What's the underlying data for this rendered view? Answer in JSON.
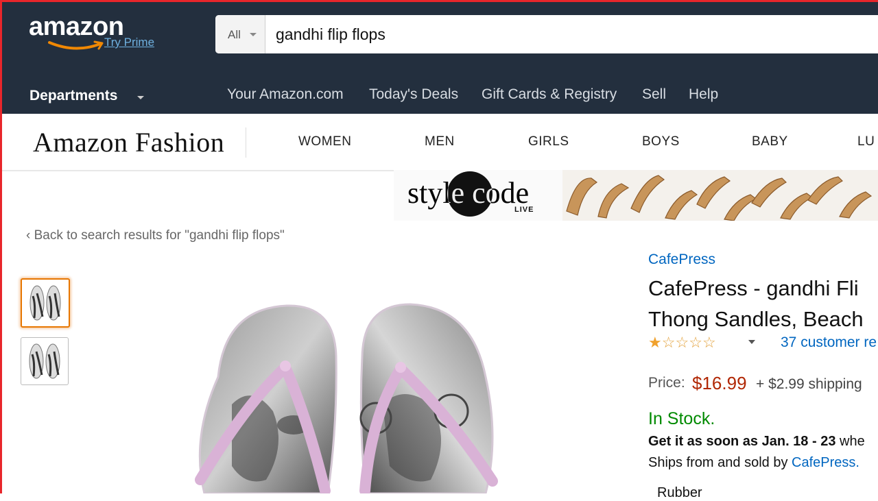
{
  "header": {
    "logo_text": "amazon",
    "try_prime": "Try Prime",
    "search": {
      "department": "All",
      "query": "gandhi flip flops"
    },
    "departments_label": "Departments",
    "nav_links": [
      "Your Amazon.com",
      "Today's Deals",
      "Gift Cards & Registry",
      "Sell",
      "Help"
    ]
  },
  "fashion": {
    "brand": "Amazon Fashion",
    "categories": [
      "WOMEN",
      "MEN",
      "GIRLS",
      "BOYS",
      "BABY",
      "LU"
    ]
  },
  "banner": {
    "text": "style code",
    "sub": "LIVE"
  },
  "back_link": "‹ Back to search results for \"gandhi flip flops\"",
  "product": {
    "brand": "CafePress",
    "title_line1": "CafePress - gandhi Fli",
    "title_line2": "Thong Sandles, Beach",
    "rating_stars": 1,
    "rating_out_of": 5,
    "reviews": "37 customer re",
    "price_label": "Price:",
    "price": "$16.99",
    "shipping": "+ $2.99 shipping",
    "availability": "In Stock.",
    "delivery_prefix": "Get it as soon as Jan. 18 - 23",
    "delivery_suffix": "whe",
    "ships_prefix": "Ships from and sold by",
    "seller": "CafePress.",
    "bullet_1": "Rubber"
  },
  "colors": {
    "header_bg": "#232f3e",
    "price": "#b12704",
    "in_stock": "#008a00",
    "link": "#0066c0",
    "thumb_active_border": "#e77600",
    "strap": "#d9b2d6"
  },
  "icons": {
    "dept_caret": "chevron-down-icon",
    "star": "star-icon",
    "smile": "amazon-smile-icon"
  }
}
